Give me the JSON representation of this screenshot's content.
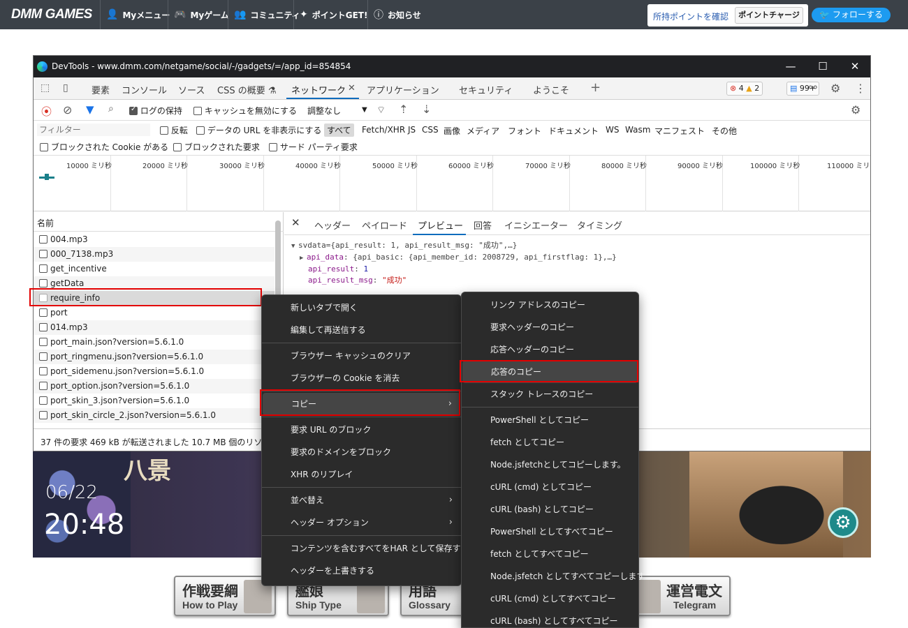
{
  "dmm": {
    "logo": "DMM GAMES",
    "nav": [
      {
        "icon": "👤",
        "label": "Myメニュー"
      },
      {
        "icon": "🎮",
        "label": "Myゲーム"
      },
      {
        "icon": "👥",
        "label": "コミュニティ"
      },
      {
        "icon": "✦",
        "label": "ポイントGET!"
      },
      {
        "icon": "ⓘ",
        "label": "お知らせ"
      }
    ],
    "point_link": "所持ポイントを確認",
    "point_charge": "ポイントチャージ",
    "follow": "🐦 フォローする"
  },
  "devtools": {
    "title": "DevTools - www.dmm.com/netgame/social/-/gadgets/=/app_id=854854",
    "window_controls": [
      "—",
      "☐",
      "✕"
    ],
    "tabs": [
      "要素",
      "コンソール",
      "ソース",
      "CSS の概要 ⚗",
      "ネットワーク",
      "アプリケーション",
      "セキュリティ",
      "ようこそ"
    ],
    "tab_close": "✕",
    "tab_add": "+",
    "badges": {
      "errors": "4",
      "warnings": "2",
      "messages": "99+"
    },
    "toolbar": {
      "preserve_log": "ログの保持",
      "disable_cache": "キャッシュを無効にする",
      "throttling": "調整なし",
      "throttling_arrow": "▼"
    },
    "filter": {
      "placeholder": "フィルター",
      "invert": "反転",
      "hide_data_urls": "データの URL を非表示にする",
      "types": [
        "すべて",
        "Fetch/XHR",
        "JS",
        "CSS",
        "画像",
        "メディア",
        "フォント",
        "ドキュメント",
        "WS",
        "Wasm",
        "マニフェスト",
        "その他"
      ],
      "blocked_cookies": "ブロックされた Cookie がある",
      "blocked_requests": "ブロックされた要求",
      "third_party": "サード パーティ要求"
    },
    "overview_ticks": [
      "10000 ミリ秒",
      "20000 ミリ秒",
      "30000 ミリ秒",
      "40000 ミリ秒",
      "50000 ミリ秒",
      "60000 ミリ秒",
      "70000 ミリ秒",
      "80000 ミリ秒",
      "90000 ミリ秒",
      "100000 ミリ秒",
      "110000 ミリ"
    ],
    "requests_header": "名前",
    "requests": [
      "004.mp3",
      "000_7138.mp3",
      "get_incentive",
      "getData",
      "require_info",
      "port",
      "014.mp3",
      "port_main.json?version=5.6.1.0",
      "port_ringmenu.json?version=5.6.1.0",
      "port_sidemenu.json?version=5.6.1.0",
      "port_option.json?version=5.6.1.0",
      "port_skin_3.json?version=5.6.1.0",
      "port_skin_circle_2.json?version=5.6.1.0"
    ],
    "status": "37 件の要求  469 kB が転送されました  10.7 MB 個のリソー",
    "detail_tabs": [
      "ヘッダー",
      "ペイロード",
      "プレビュー",
      "回答",
      "イニシエーター",
      "タイミング"
    ],
    "preview": {
      "line1": "svdata={api_result: 1, api_result_msg: \"成功\",…}",
      "api_data_key": "api_data",
      "api_data_val": "{api_basic: {api_member_id: 2008729, api_firstflag: 1},…}",
      "api_result_key": "api_result",
      "api_result_val": "1",
      "api_result_msg_key": "api_result_msg",
      "api_result_msg_val": "\"成功\""
    }
  },
  "context_menu": {
    "items": [
      "新しいタブで開く",
      "編集して再送信する",
      "ブラウザー キャッシュのクリア",
      "ブラウザーの Cookie を消去",
      "コピー",
      "要求 URL のブロック",
      "要求のドメインをブロック",
      "XHR のリプレイ",
      "並べ替え",
      "ヘッダー オプション",
      "コンテンツを含むすべてをHAR として保存する",
      "ヘッダーを上書きする"
    ],
    "arrow": "›"
  },
  "copy_submenu": {
    "items": [
      "リンク アドレスのコピー",
      "要求ヘッダーのコピー",
      "応答ヘッダーのコピー",
      "応答のコピー",
      "スタック トレースのコピー",
      "PowerShell としてコピー",
      "fetch としてコピー",
      "Node.jsfetchとしてコピーします。",
      "cURL (cmd) としてコピー",
      "cURL (bash) としてコピー",
      "PowerShell としてすべてコピー",
      "fetch としてすべてコピー",
      "Node.jsfetch としてすべてコピーします",
      "cURL (cmd) としてすべてコピー",
      "cURL (bash) としてすべてコピー"
    ]
  },
  "game": {
    "title_chars": "八景",
    "date": "06/22",
    "time": "20:48",
    "gear": "⚙",
    "banners": [
      {
        "jp": "作戦要綱",
        "en": "How to Play"
      },
      {
        "jp": "艦娘",
        "en": "Ship Type"
      },
      {
        "jp": "用語",
        "en": "Glossary"
      },
      {
        "jp": "運営電文",
        "en": "Telegram"
      }
    ]
  },
  "colors": {
    "accent": "#0f6cbd",
    "highlight": "#e30000",
    "menu_bg": "#2b2b2b"
  }
}
